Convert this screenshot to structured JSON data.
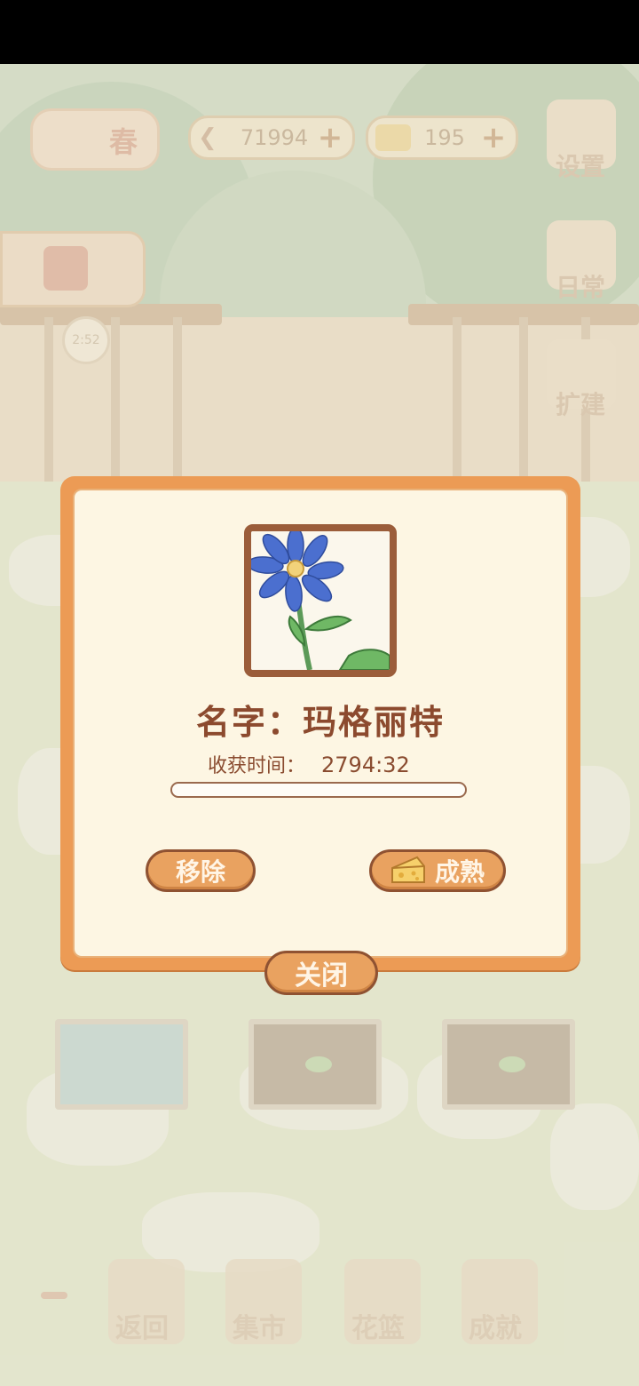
{
  "hud": {
    "season": "春",
    "fish_count": "71994",
    "cheese_count": "195",
    "clock": "2:52",
    "settings_label": "设置",
    "daily_label": "日常",
    "expand_label": "扩建"
  },
  "dialog": {
    "name_text": "名字：玛格丽特",
    "harvest_label": "收获时间：",
    "harvest_value": "2794:32",
    "progress": 0.0,
    "remove_label": "移除",
    "mature_label": "成熟",
    "close_label": "关闭"
  },
  "dock": {
    "back_label": "返回",
    "market_label": "集市",
    "basket_label": "花篮",
    "achievement_label": "成就"
  },
  "colors": {
    "dialog_border": "#ec9b55",
    "dialog_bg": "#fdf6e3",
    "button": "#e9a260",
    "text_brown": "#8c4a2e",
    "flower_blue": "#4b6fcf"
  },
  "icons": [
    "flower-icon",
    "cheese-icon",
    "fish-bone-icon",
    "gear-icon",
    "watering-can-icon",
    "clock-icon"
  ]
}
